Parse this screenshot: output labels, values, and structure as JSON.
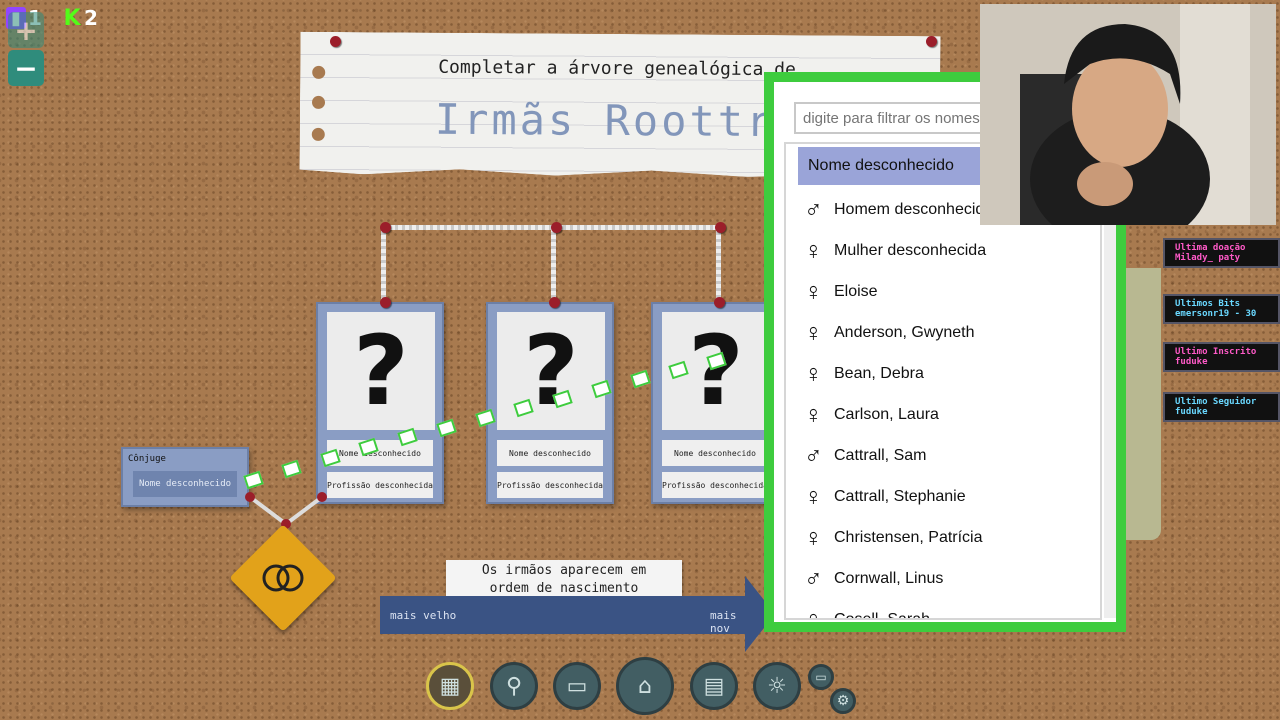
{
  "stream": {
    "twitch_count": "1",
    "kick_count": "2",
    "zoom_in": "+",
    "zoom_out": "−"
  },
  "title": {
    "sub": "Completar a árvore genealógica de",
    "main": "Irmãs Roottre"
  },
  "cards": [
    {
      "photo": "?",
      "name": "Nome desconhecido",
      "profession": "Profissão desconhecida"
    },
    {
      "photo": "?",
      "name": "Nome desconhecido",
      "profession": "Profissão desconhecida"
    },
    {
      "photo": "?",
      "name": "Nome desconhecido",
      "profession": "Profissão desconhecida"
    }
  ],
  "spouse": {
    "label": "Cônjuge",
    "name": "Nome desconhecido"
  },
  "note": {
    "line1": "Os irmãos aparecem em",
    "line2": "ordem de nascimento"
  },
  "arrow": {
    "left": "mais velho",
    "right": "mais nov"
  },
  "dropdown": {
    "placeholder": "digite para filtrar os nomes",
    "selected": "Nome desconhecido",
    "items": [
      {
        "glyph": "♂",
        "label": "Homem desconhecido"
      },
      {
        "glyph": "♀",
        "label": "Mulher desconhecida"
      },
      {
        "glyph": "♀",
        "label": "Eloise"
      },
      {
        "glyph": "♀",
        "label": "Anderson, Gwyneth"
      },
      {
        "glyph": "♀",
        "label": "Bean, Debra"
      },
      {
        "glyph": "♀",
        "label": "Carlson, Laura"
      },
      {
        "glyph": "♂",
        "label": "Cattrall, Sam"
      },
      {
        "glyph": "♀",
        "label": "Cattrall, Stephanie"
      },
      {
        "glyph": "♀",
        "label": "Christensen, Patrícia"
      },
      {
        "glyph": "♂",
        "label": "Cornwall, Linus"
      },
      {
        "glyph": "♀",
        "label": "Cosell, Sarah"
      }
    ]
  },
  "widgets": [
    {
      "title": "Ultima doação",
      "value": "Milady_ paty",
      "color": "#ff5ac8"
    },
    {
      "title": "Ultimos Bits",
      "value": "emersonr19 - 30",
      "color": "#6ad8ff"
    },
    {
      "title": "Ultimo Inscrito",
      "value": "fuduke",
      "color": "#ff5ac8"
    },
    {
      "title": "Ultimo Seguidor",
      "value": "fuduke",
      "color": "#6ad8ff"
    }
  ],
  "colors": {
    "accent_green": "#3ecc3e",
    "card_blue": "#8a9dc4",
    "selected": "#9aa4d8"
  }
}
